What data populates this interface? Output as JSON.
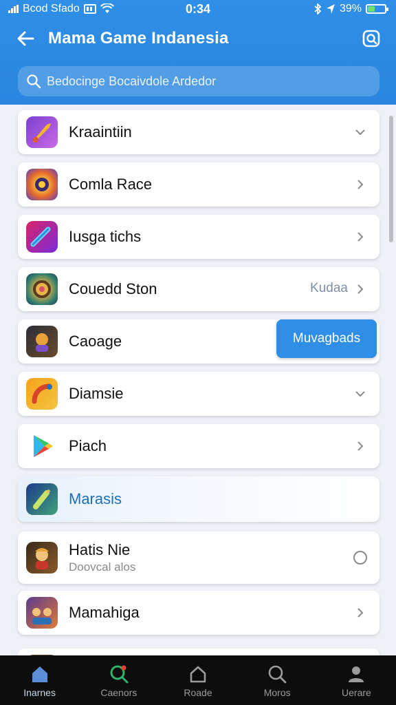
{
  "status": {
    "carrier": "Bcod Sfado",
    "time": "0:34",
    "battery": "39%",
    "battery_level": 0.39
  },
  "header": {
    "title": "Mama Game Indanesia",
    "search_placeholder": "Bedocinge Bocaivdole Ardedor"
  },
  "list": [
    {
      "name": "Kraaintiin",
      "trailing": "chevron-down"
    },
    {
      "name": "Comla Race",
      "trailing": "chevron-right"
    },
    {
      "name": "Iusga tichs",
      "trailing": "chevron-right"
    },
    {
      "name": "Couedd Ston",
      "meta": "Kudaa",
      "trailing": "chevron-right"
    },
    {
      "name": "Caoage",
      "button": "Muvagbads"
    },
    {
      "name": "Diamsie",
      "trailing": "chevron-down"
    },
    {
      "name": "Piach",
      "trailing": "chevron-right"
    },
    {
      "name": "Marasis",
      "selected": true
    },
    {
      "name": "Hatis Nie",
      "subtitle": "Doovcal alos",
      "trailing": "radio"
    },
    {
      "name": "Mamahiga",
      "trailing": "chevron-right"
    }
  ],
  "nav": [
    {
      "label": "Inarnes",
      "icon": "home-icon"
    },
    {
      "label": "Caenors",
      "icon": "search-icon"
    },
    {
      "label": "Roade",
      "icon": "house-icon"
    },
    {
      "label": "Moros",
      "icon": "search-icon"
    },
    {
      "label": "Uerare",
      "icon": "user-icon"
    }
  ],
  "colors": {
    "header": "#2f8ee6",
    "accent": "#2f8ee6",
    "nav_bg": "#0d0d0d"
  }
}
